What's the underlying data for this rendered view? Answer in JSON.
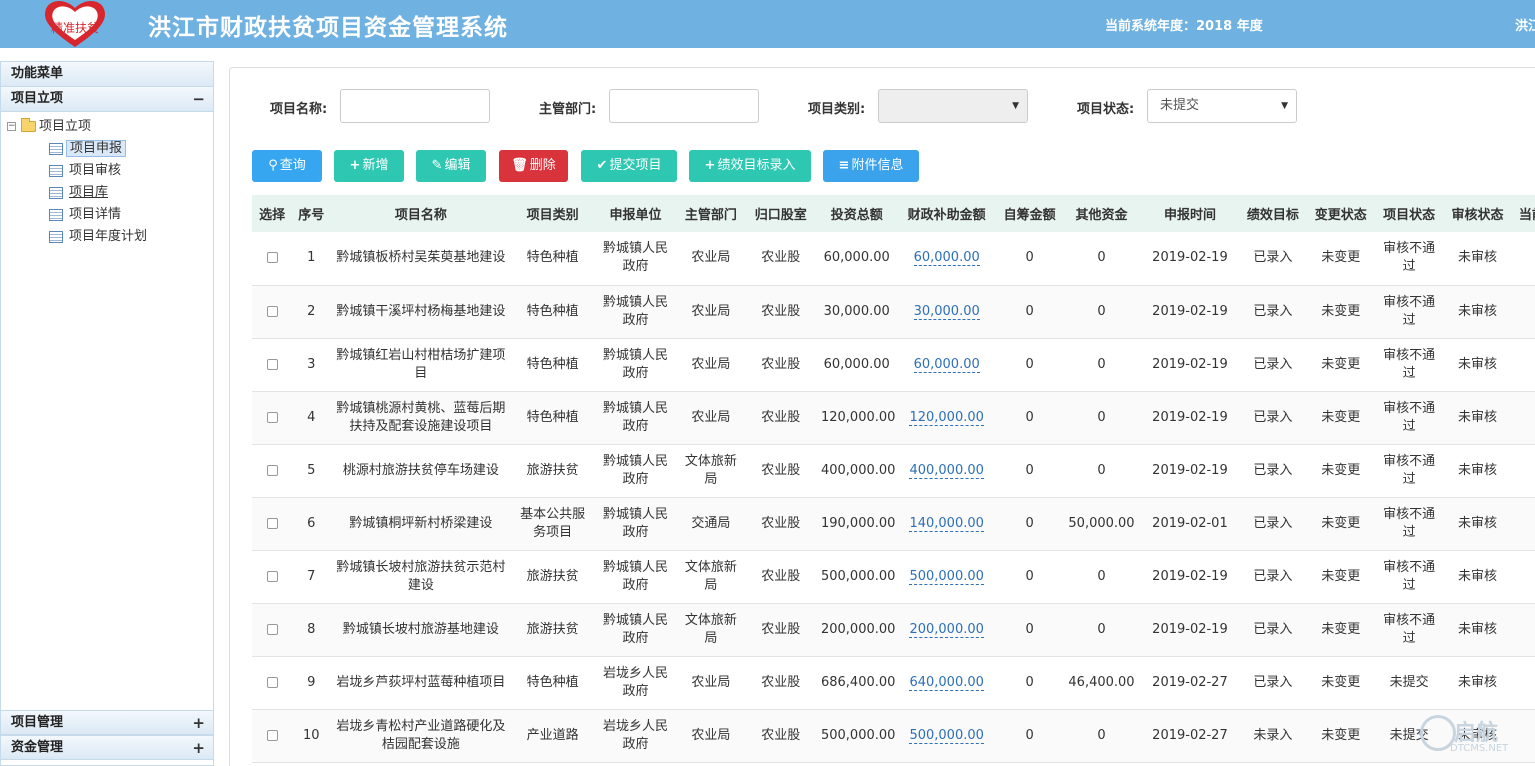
{
  "header": {
    "logo_text": "精准扶贫",
    "title": "洪江市财政扶贫项目资金管理系统",
    "year_info": "当前系统年度：2018 年度",
    "user_info": "洪江"
  },
  "sidebar": {
    "menu_title": "功能菜单",
    "section_title": "项目立项",
    "section_toggle": "−",
    "tree_root": "项目立项",
    "tree_items": [
      {
        "label": "项目申报"
      },
      {
        "label": "项目审核"
      },
      {
        "label": "项目库"
      },
      {
        "label": "项目详情"
      },
      {
        "label": "项目年度计划"
      }
    ],
    "bottom_panels": [
      {
        "label": "项目管理",
        "toggle": "+"
      },
      {
        "label": "资金管理",
        "toggle": "+"
      }
    ]
  },
  "filters": {
    "name_label": "项目名称:",
    "name_value": "",
    "dept_label": "主管部门:",
    "dept_value": "",
    "category_label": "项目类别:",
    "category_value": "",
    "status_label": "项目状态:",
    "status_value": "未提交"
  },
  "toolbar": {
    "query": "查询",
    "add": "新增",
    "edit": "编辑",
    "delete": "删除",
    "submit": "提交项目",
    "goal": "绩效目标录入",
    "attachment": "附件信息"
  },
  "table": {
    "headers": [
      "选择",
      "序号",
      "项目名称",
      "项目类别",
      "申报单位",
      "主管部门",
      "归口股室",
      "投资总额",
      "财政补助金额",
      "自筹金额",
      "其他资金",
      "申报时间",
      "绩效目标",
      "变更状态",
      "项目状态",
      "审核状态",
      "当前"
    ],
    "rows": [
      {
        "no": "1",
        "name": "黔城镇板桥村吴茱萸基地建设",
        "category": "特色种植",
        "unit": "黔城镇人民政府",
        "dept": "农业局",
        "office": "农业股",
        "total": "60,000.00",
        "subsidy": "60,000.00",
        "self": "0",
        "other": "0",
        "date": "2019-02-19",
        "goal": "已录入",
        "change": "未变更",
        "status": "审核不通过",
        "audit": "未审核"
      },
      {
        "no": "2",
        "name": "黔城镇干溪坪村杨梅基地建设",
        "category": "特色种植",
        "unit": "黔城镇人民政府",
        "dept": "农业局",
        "office": "农业股",
        "total": "30,000.00",
        "subsidy": "30,000.00",
        "self": "0",
        "other": "0",
        "date": "2019-02-19",
        "goal": "已录入",
        "change": "未变更",
        "status": "审核不通过",
        "audit": "未审核"
      },
      {
        "no": "3",
        "name": "黔城镇红岩山村柑桔场扩建项目",
        "category": "特色种植",
        "unit": "黔城镇人民政府",
        "dept": "农业局",
        "office": "农业股",
        "total": "60,000.00",
        "subsidy": "60,000.00",
        "self": "0",
        "other": "0",
        "date": "2019-02-19",
        "goal": "已录入",
        "change": "未变更",
        "status": "审核不通过",
        "audit": "未审核"
      },
      {
        "no": "4",
        "name": "黔城镇桃源村黄桃、蓝莓后期扶持及配套设施建设项目",
        "category": "特色种植",
        "unit": "黔城镇人民政府",
        "dept": "农业局",
        "office": "农业股",
        "total": "120,000.00",
        "subsidy": "120,000.00",
        "self": "0",
        "other": "0",
        "date": "2019-02-19",
        "goal": "已录入",
        "change": "未变更",
        "status": "审核不通过",
        "audit": "未审核"
      },
      {
        "no": "5",
        "name": "桃源村旅游扶贫停车场建设",
        "category": "旅游扶贫",
        "unit": "黔城镇人民政府",
        "dept": "文体旅新局",
        "office": "农业股",
        "total": "400,000.00",
        "subsidy": "400,000.00",
        "self": "0",
        "other": "0",
        "date": "2019-02-19",
        "goal": "已录入",
        "change": "未变更",
        "status": "审核不通过",
        "audit": "未审核"
      },
      {
        "no": "6",
        "name": "黔城镇桐坪新村桥梁建设",
        "category": "基本公共服务项目",
        "unit": "黔城镇人民政府",
        "dept": "交通局",
        "office": "农业股",
        "total": "190,000.00",
        "subsidy": "140,000.00",
        "self": "0",
        "other": "50,000.00",
        "date": "2019-02-01",
        "goal": "已录入",
        "change": "未变更",
        "status": "审核不通过",
        "audit": "未审核"
      },
      {
        "no": "7",
        "name": "黔城镇长坡村旅游扶贫示范村建设",
        "category": "旅游扶贫",
        "unit": "黔城镇人民政府",
        "dept": "文体旅新局",
        "office": "农业股",
        "total": "500,000.00",
        "subsidy": "500,000.00",
        "self": "0",
        "other": "0",
        "date": "2019-02-19",
        "goal": "已录入",
        "change": "未变更",
        "status": "审核不通过",
        "audit": "未审核"
      },
      {
        "no": "8",
        "name": "黔城镇长坡村旅游基地建设",
        "category": "旅游扶贫",
        "unit": "黔城镇人民政府",
        "dept": "文体旅新局",
        "office": "农业股",
        "total": "200,000.00",
        "subsidy": "200,000.00",
        "self": "0",
        "other": "0",
        "date": "2019-02-19",
        "goal": "已录入",
        "change": "未变更",
        "status": "审核不通过",
        "audit": "未审核"
      },
      {
        "no": "9",
        "name": "岩垅乡芦荻坪村蓝莓种植项目",
        "category": "特色种植",
        "unit": "岩垅乡人民政府",
        "dept": "农业局",
        "office": "农业股",
        "total": "686,400.00",
        "subsidy": "640,000.00",
        "self": "0",
        "other": "46,400.00",
        "date": "2019-02-27",
        "goal": "已录入",
        "change": "未变更",
        "status": "未提交",
        "audit": "未审核"
      },
      {
        "no": "10",
        "name": "岩垅乡青松村产业道路硬化及桔园配套设施",
        "category": "产业道路",
        "unit": "岩垅乡人民政府",
        "dept": "农业局",
        "office": "农业股",
        "total": "500,000.00",
        "subsidy": "500,000.00",
        "self": "0",
        "other": "0",
        "date": "2019-02-27",
        "goal": "未录入",
        "change": "未变更",
        "status": "未提交",
        "audit": "未审核"
      }
    ]
  },
  "watermark": {
    "text": "启航",
    "sub": "DTCMS.NET"
  },
  "colors": {
    "header": "#6fb1e0",
    "accent": "#37a6f0",
    "teal": "#2ec7b2",
    "danger": "#d9333b"
  }
}
